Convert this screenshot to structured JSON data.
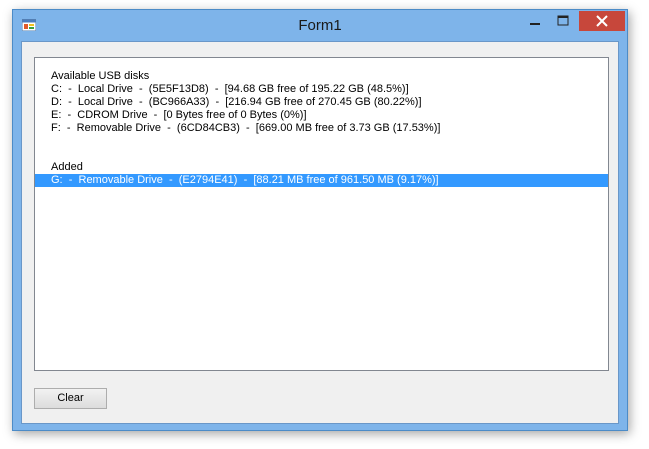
{
  "window": {
    "title": "Form1"
  },
  "listbox": {
    "header": "Available USB disks",
    "drives": [
      "C:  -  Local Drive  -  (5E5F13D8)  -  [94.68 GB free of 195.22 GB (48.5%)]",
      "D:  -  Local Drive  -  (BC966A33)  -  [216.94 GB free of 270.45 GB (80.22%)]",
      "E:  -  CDROM Drive  -  [0 Bytes free of 0 Bytes (0%)]",
      "F:  -  Removable Drive  -  (6CD84CB3)  -  [669.00 MB free of 3.73 GB (17.53%)]"
    ],
    "added_header": "Added",
    "added_items": [
      "G:  -  Removable Drive  -  (E2794E41)  -  [88.21 MB free of 961.50 MB (9.17%)]"
    ]
  },
  "buttons": {
    "clear_label": "Clear"
  },
  "icons": {
    "app": "app-icon",
    "minimize": "minimize-icon",
    "maximize": "maximize-icon",
    "close": "close-icon"
  },
  "colors": {
    "selection": "#3399ff",
    "close_button": "#c7473b",
    "frame": "#7eb4ea"
  }
}
